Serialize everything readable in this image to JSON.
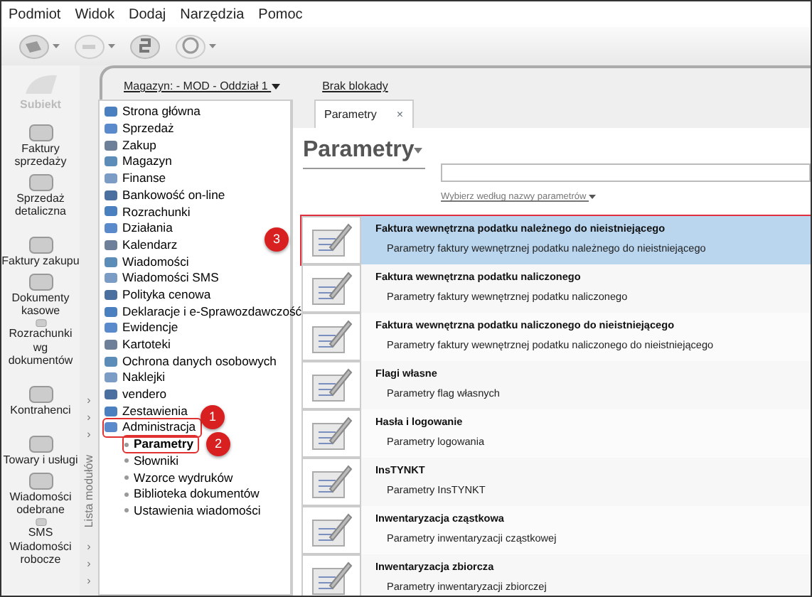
{
  "menu": [
    "Podmiot",
    "Widok",
    "Dodaj",
    "Narzędzia",
    "Pomoc"
  ],
  "logo": {
    "label": "Subiekt"
  },
  "sidebar": {
    "items": [
      {
        "label": "Faktury sprzedaży"
      },
      {
        "label": "Sprzedaż detaliczna"
      },
      {
        "label": "Faktury zakupu"
      },
      {
        "label": "Dokumenty kasowe"
      },
      {
        "label": "Rozrachunki wg dokumentów"
      },
      {
        "label": "Kontrahenci"
      },
      {
        "label": "Towary i usługi"
      },
      {
        "label": "Wiadomości odebrane"
      },
      {
        "label": "SMS Wiadomości robocze"
      }
    ]
  },
  "module_strip": {
    "chevrons_top": [
      "›",
      "›",
      "›"
    ],
    "label": "Lista modułów",
    "chevrons_bottom": [
      "›",
      "›",
      "›"
    ]
  },
  "context_bar": {
    "warehouse": "Magazyn: - MOD - Oddział 1",
    "lock": "Brak blokady"
  },
  "tree": [
    {
      "label": "Strona główna"
    },
    {
      "label": "Sprzedaż"
    },
    {
      "label": "Zakup"
    },
    {
      "label": "Magazyn"
    },
    {
      "label": "Finanse"
    },
    {
      "label": "Bankowość on-line"
    },
    {
      "label": "Rozrachunki"
    },
    {
      "label": "Działania"
    },
    {
      "label": "Kalendarz"
    },
    {
      "label": "Wiadomości"
    },
    {
      "label": "Wiadomości SMS"
    },
    {
      "label": "Polityka cenowa"
    },
    {
      "label": "Deklaracje i e-Sprawozdawczość"
    },
    {
      "label": "Ewidencje"
    },
    {
      "label": "Kartoteki"
    },
    {
      "label": "Ochrona danych osobowych"
    },
    {
      "label": "Naklejki"
    },
    {
      "label": "vendero"
    },
    {
      "label": "Zestawienia"
    },
    {
      "label": "Administracja",
      "marker": "1",
      "children": [
        {
          "label": "Parametry",
          "selected": true,
          "marker": "2"
        },
        {
          "label": "Słowniki",
          "selected": false
        },
        {
          "label": "Wzorce wydruków",
          "selected": false
        },
        {
          "label": "Biblioteka dokumentów",
          "selected": false
        },
        {
          "label": "Ustawienia wiadomości",
          "selected": false
        }
      ]
    }
  ],
  "tabs": [
    {
      "label": "Parametry",
      "selected": true,
      "close": "×"
    }
  ],
  "heading": "Parametry",
  "filter_link": "Wybierz według nazwy parametrów",
  "rows": [
    {
      "title": "Faktura wewnętrzna podatku należnego do nieistniejącego",
      "subtitle": "Parametry faktury wewnętrznej podatku należnego do nieistniejącego",
      "selected": true,
      "marker": "3"
    },
    {
      "title": "Faktura wewnętrzna podatku naliczonego",
      "subtitle": "Parametry faktury wewnętrznej podatku naliczonego",
      "selected": false
    },
    {
      "title": "Faktura wewnętrzna podatku naliczonego do nieistniejącego",
      "subtitle": "Parametry faktury wewnętrznej podatku naliczonego do nieistniejącego",
      "selected": false
    },
    {
      "title": "Flagi własne",
      "subtitle": "Parametry flag własnych",
      "selected": false
    },
    {
      "title": "Hasła i logowanie",
      "subtitle": "Parametry logowania",
      "selected": false
    },
    {
      "title": "InsTYNKT",
      "subtitle": "Parametry InsTYNKT",
      "selected": false
    },
    {
      "title": "Inwentaryzacja cząstkowa",
      "subtitle": "Parametry inwentaryzacji cząstkowej",
      "selected": false
    },
    {
      "title": "Inwentaryzacja zbiorcza",
      "subtitle": "Parametry inwentaryzacji zbiorczej",
      "selected": false
    }
  ]
}
